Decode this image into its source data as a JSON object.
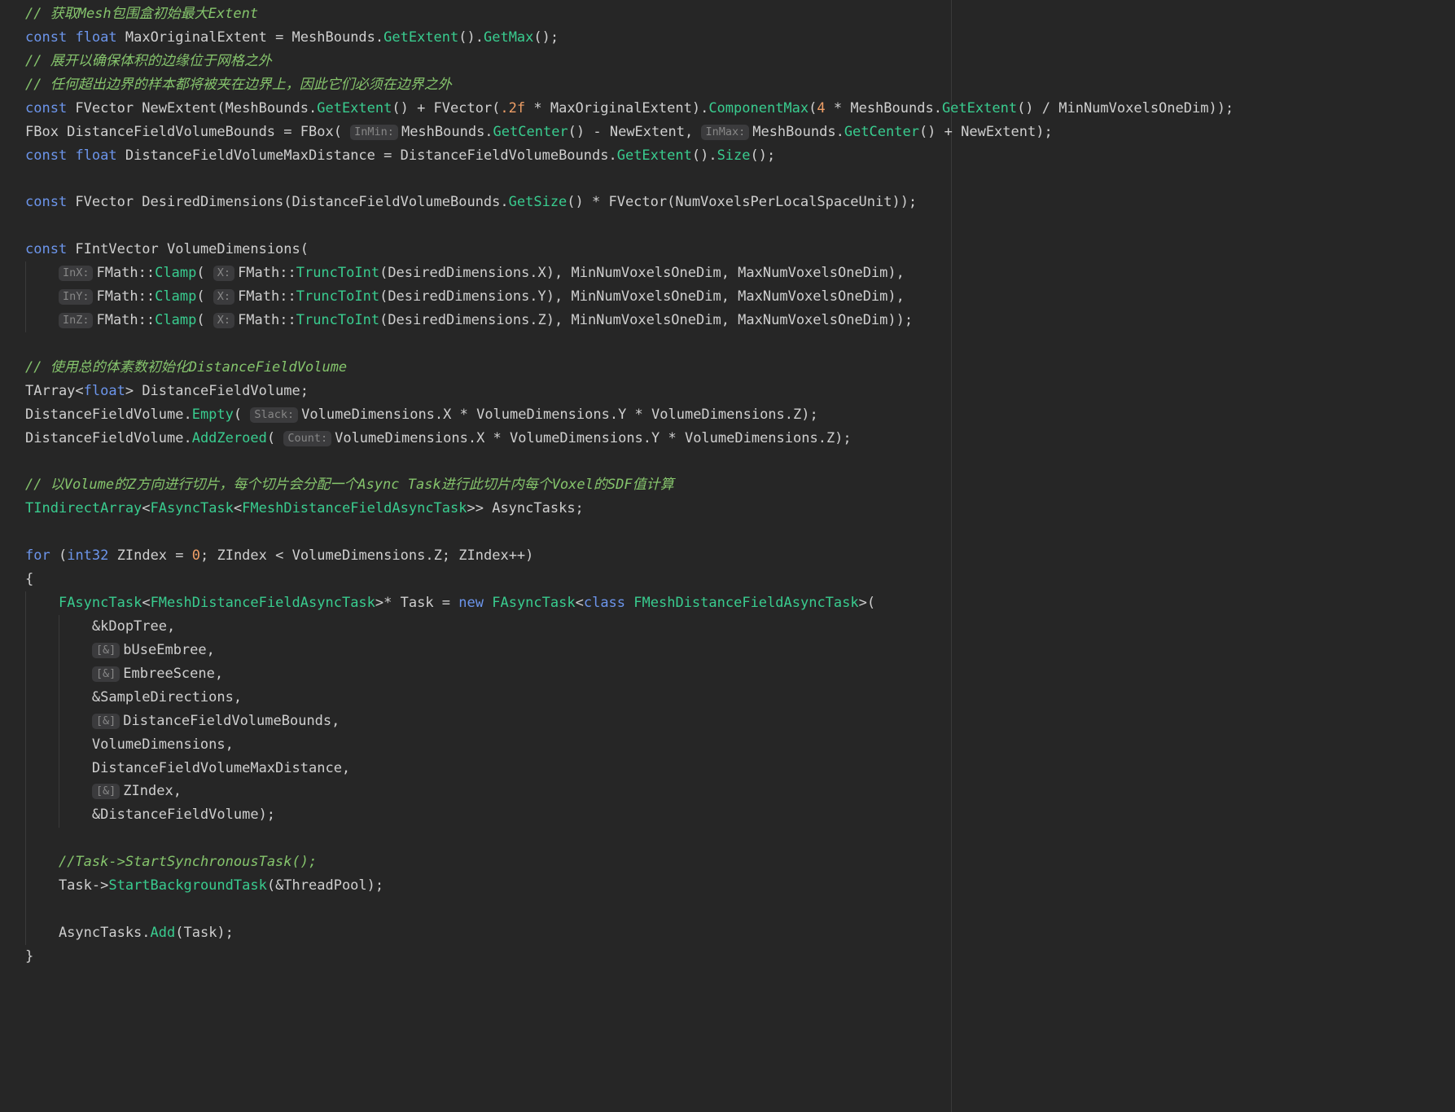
{
  "colors": {
    "background": "#262626",
    "plain": "#CFCFCF",
    "keyword": "#6C95EB",
    "method": "#39CC8F",
    "type": "#39CC8F",
    "number": "#ED9E66",
    "comment": "#85C46C",
    "hint-bg": "#3B3B3D",
    "hint-text": "#868686",
    "guide": "#3A3A3A"
  },
  "editor": {
    "language": "cpp",
    "lines": [
      {
        "tokens": [
          [
            "com",
            "// 获取Mesh包围盒初始最大Extent"
          ]
        ]
      },
      {
        "tokens": [
          [
            "kw",
            "const"
          ],
          [
            "pl",
            " "
          ],
          [
            "kw",
            "float"
          ],
          [
            "pl",
            " MaxOriginalExtent = MeshBounds."
          ],
          [
            "fn",
            "GetExtent"
          ],
          [
            "pl",
            "()."
          ],
          [
            "fn",
            "GetMax"
          ],
          [
            "pl",
            "();"
          ]
        ]
      },
      {
        "tokens": [
          [
            "com",
            "// 展开以确保体积的边缘位于网格之外"
          ]
        ]
      },
      {
        "tokens": [
          [
            "com",
            "// 任何超出边界的样本都将被夹在边界上，因此它们必须在边界之外"
          ]
        ]
      },
      {
        "tokens": [
          [
            "kw",
            "const"
          ],
          [
            "pl",
            " FVector NewExtent(MeshBounds."
          ],
          [
            "fn",
            "GetExtent"
          ],
          [
            "pl",
            "() + FVector("
          ],
          [
            "num",
            ".2f"
          ],
          [
            "pl",
            " * MaxOriginalExtent)."
          ],
          [
            "fn",
            "ComponentMax"
          ],
          [
            "pl",
            "("
          ],
          [
            "num",
            "4"
          ],
          [
            "pl",
            " * MeshBounds."
          ],
          [
            "fn",
            "GetExtent"
          ],
          [
            "pl",
            "() / MinNumVoxelsOneDim));"
          ]
        ]
      },
      {
        "tokens": [
          [
            "pl",
            "FBox DistanceFieldVolumeBounds = FBox( "
          ],
          [
            "hint",
            "InMin:"
          ],
          [
            "pl",
            "MeshBounds."
          ],
          [
            "fn",
            "GetCenter"
          ],
          [
            "pl",
            "() - NewExtent, "
          ],
          [
            "hint",
            "InMax:"
          ],
          [
            "pl",
            "MeshBounds."
          ],
          [
            "fn",
            "GetCenter"
          ],
          [
            "pl",
            "() + NewExtent);"
          ]
        ]
      },
      {
        "tokens": [
          [
            "kw",
            "const"
          ],
          [
            "pl",
            " "
          ],
          [
            "kw",
            "float"
          ],
          [
            "pl",
            " DistanceFieldVolumeMaxDistance = DistanceFieldVolumeBounds."
          ],
          [
            "fn",
            "GetExtent"
          ],
          [
            "pl",
            "()."
          ],
          [
            "fn",
            "Size"
          ],
          [
            "pl",
            "();"
          ]
        ]
      },
      {
        "tokens": []
      },
      {
        "tokens": [
          [
            "kw",
            "const"
          ],
          [
            "pl",
            " FVector DesiredDimensions(DistanceFieldVolumeBounds."
          ],
          [
            "fn",
            "GetSize"
          ],
          [
            "pl",
            "() * FVector(NumVoxelsPerLocalSpaceUnit));"
          ]
        ]
      },
      {
        "tokens": []
      },
      {
        "tokens": [
          [
            "kw",
            "const"
          ],
          [
            "pl",
            " FIntVector VolumeDimensions("
          ]
        ]
      },
      {
        "tokens": [
          [
            "pl",
            "    "
          ],
          [
            "hint",
            "InX:"
          ],
          [
            "pl",
            "FMath::"
          ],
          [
            "fn",
            "Clamp"
          ],
          [
            "pl",
            "( "
          ],
          [
            "hint",
            "X:"
          ],
          [
            "pl",
            "FMath::"
          ],
          [
            "fn",
            "TruncToInt"
          ],
          [
            "pl",
            "(DesiredDimensions.X), MinNumVoxelsOneDim, MaxNumVoxelsOneDim),"
          ]
        ]
      },
      {
        "tokens": [
          [
            "pl",
            "    "
          ],
          [
            "hint",
            "InY:"
          ],
          [
            "pl",
            "FMath::"
          ],
          [
            "fn",
            "Clamp"
          ],
          [
            "pl",
            "( "
          ],
          [
            "hint",
            "X:"
          ],
          [
            "pl",
            "FMath::"
          ],
          [
            "fn",
            "TruncToInt"
          ],
          [
            "pl",
            "(DesiredDimensions.Y), MinNumVoxelsOneDim, MaxNumVoxelsOneDim),"
          ]
        ]
      },
      {
        "tokens": [
          [
            "pl",
            "    "
          ],
          [
            "hint",
            "InZ:"
          ],
          [
            "pl",
            "FMath::"
          ],
          [
            "fn",
            "Clamp"
          ],
          [
            "pl",
            "( "
          ],
          [
            "hint",
            "X:"
          ],
          [
            "pl",
            "FMath::"
          ],
          [
            "fn",
            "TruncToInt"
          ],
          [
            "pl",
            "(DesiredDimensions.Z), MinNumVoxelsOneDim, MaxNumVoxelsOneDim));"
          ]
        ]
      },
      {
        "tokens": []
      },
      {
        "tokens": [
          [
            "com",
            "// 使用总的体素数初始化DistanceFieldVolume"
          ]
        ]
      },
      {
        "tokens": [
          [
            "pl",
            "TArray<"
          ],
          [
            "kw",
            "float"
          ],
          [
            "pl",
            "> DistanceFieldVolume;"
          ]
        ]
      },
      {
        "tokens": [
          [
            "pl",
            "DistanceFieldVolume."
          ],
          [
            "fn",
            "Empty"
          ],
          [
            "pl",
            "( "
          ],
          [
            "hint",
            "Slack:"
          ],
          [
            "pl",
            "VolumeDimensions.X * VolumeDimensions.Y * VolumeDimensions.Z);"
          ]
        ]
      },
      {
        "tokens": [
          [
            "pl",
            "DistanceFieldVolume."
          ],
          [
            "fn",
            "AddZeroed"
          ],
          [
            "pl",
            "( "
          ],
          [
            "hint",
            "Count:"
          ],
          [
            "pl",
            "VolumeDimensions.X * VolumeDimensions.Y * VolumeDimensions.Z);"
          ]
        ]
      },
      {
        "tokens": []
      },
      {
        "tokens": [
          [
            "com",
            "// 以Volume的Z方向进行切片，每个切片会分配一个Async Task进行此切片内每个Voxel的SDF值计算"
          ]
        ]
      },
      {
        "tokens": [
          [
            "ty",
            "TIndirectArray"
          ],
          [
            "pl",
            "<"
          ],
          [
            "ty",
            "FAsyncTask"
          ],
          [
            "pl",
            "<"
          ],
          [
            "ty",
            "FMeshDistanceFieldAsyncTask"
          ],
          [
            "pl",
            ">> AsyncTasks;"
          ]
        ]
      },
      {
        "tokens": []
      },
      {
        "tokens": [
          [
            "kw",
            "for"
          ],
          [
            "pl",
            " ("
          ],
          [
            "kw",
            "int32"
          ],
          [
            "pl",
            " ZIndex = "
          ],
          [
            "num",
            "0"
          ],
          [
            "pl",
            "; ZIndex < VolumeDimensions.Z; ZIndex++)"
          ]
        ]
      },
      {
        "tokens": [
          [
            "pl",
            "{"
          ]
        ]
      },
      {
        "tokens": [
          [
            "pl",
            "    "
          ],
          [
            "ty",
            "FAsyncTask"
          ],
          [
            "pl",
            "<"
          ],
          [
            "ty",
            "FMeshDistanceFieldAsyncTask"
          ],
          [
            "pl",
            ">* Task = "
          ],
          [
            "kw",
            "new"
          ],
          [
            "pl",
            " "
          ],
          [
            "ty",
            "FAsyncTask"
          ],
          [
            "pl",
            "<"
          ],
          [
            "kw",
            "class"
          ],
          [
            "pl",
            " "
          ],
          [
            "ty",
            "FMeshDistanceFieldAsyncTask"
          ],
          [
            "pl",
            ">("
          ]
        ]
      },
      {
        "tokens": [
          [
            "pl",
            "        &kDopTree,"
          ]
        ]
      },
      {
        "tokens": [
          [
            "pl",
            "        "
          ],
          [
            "hint",
            "[&]"
          ],
          [
            "pl",
            "bUseEmbree,"
          ]
        ]
      },
      {
        "tokens": [
          [
            "pl",
            "        "
          ],
          [
            "hint",
            "[&]"
          ],
          [
            "pl",
            "EmbreeScene,"
          ]
        ]
      },
      {
        "tokens": [
          [
            "pl",
            "        &SampleDirections,"
          ]
        ]
      },
      {
        "tokens": [
          [
            "pl",
            "        "
          ],
          [
            "hint",
            "[&]"
          ],
          [
            "pl",
            "DistanceFieldVolumeBounds,"
          ]
        ]
      },
      {
        "tokens": [
          [
            "pl",
            "        VolumeDimensions,"
          ]
        ]
      },
      {
        "tokens": [
          [
            "pl",
            "        DistanceFieldVolumeMaxDistance,"
          ]
        ]
      },
      {
        "tokens": [
          [
            "pl",
            "        "
          ],
          [
            "hint",
            "[&]"
          ],
          [
            "pl",
            "ZIndex,"
          ]
        ]
      },
      {
        "tokens": [
          [
            "pl",
            "        &DistanceFieldVolume);"
          ]
        ]
      },
      {
        "tokens": []
      },
      {
        "tokens": [
          [
            "pl",
            "    "
          ],
          [
            "com",
            "//Task->StartSynchronousTask();"
          ]
        ]
      },
      {
        "tokens": [
          [
            "pl",
            "    Task->"
          ],
          [
            "fn",
            "StartBackgroundTask"
          ],
          [
            "pl",
            "(&ThreadPool);"
          ]
        ]
      },
      {
        "tokens": []
      },
      {
        "tokens": [
          [
            "pl",
            "    AsyncTasks."
          ],
          [
            "fn",
            "Add"
          ],
          [
            "pl",
            "(Task);"
          ]
        ]
      },
      {
        "tokens": [
          [
            "pl",
            "}"
          ]
        ]
      }
    ]
  }
}
